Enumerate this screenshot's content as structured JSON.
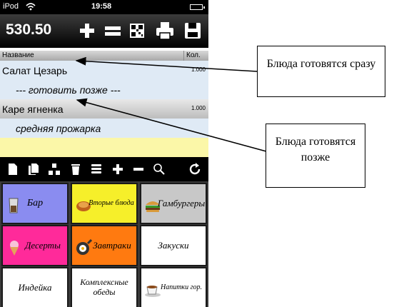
{
  "statusbar": {
    "device": "iPod",
    "time": "19:58"
  },
  "toolbar": {
    "total": "530.50",
    "icons": [
      "plus-icon",
      "equals-icon",
      "qr-code-icon",
      "printer-icon",
      "save-icon"
    ]
  },
  "table": {
    "col_name": "Название",
    "col_qty": "Кол.",
    "rows": [
      {
        "name": "Салат Цезарь",
        "qty": "1.000"
      },
      {
        "name": "--- готовить позже ---"
      },
      {
        "name": "Каре ягненка",
        "qty": "1.000"
      },
      {
        "name": "средняя прожарка"
      }
    ]
  },
  "actionbar": {
    "icons": [
      "new-document-icon",
      "copy-document-icon",
      "split-icon",
      "trash-icon",
      "stack-icon",
      "plus-icon",
      "minus-icon",
      "search-icon",
      "refresh-icon"
    ]
  },
  "categories": [
    {
      "label": "Бар",
      "color": "#8a8cf0",
      "icon": "glass-icon"
    },
    {
      "label": "Вторые блюда",
      "color": "#f6ef2a",
      "icon": "chicken-icon"
    },
    {
      "label": "Гамбургеры",
      "color": "#c8c8c8",
      "icon": "burger-icon"
    },
    {
      "label": "Десерты",
      "color": "#ff2a9a",
      "icon": "ice-cream-icon"
    },
    {
      "label": "Завтраки",
      "color": "#ff7a10",
      "icon": "pan-icon"
    },
    {
      "label": "Закуски",
      "color": "#ffffff"
    },
    {
      "label": "Индейка",
      "color": "#ffffff"
    },
    {
      "label": "Комплексные обеды",
      "color": "#ffffff"
    },
    {
      "label": "Напитки гор.",
      "color": "#ffffff",
      "icon": "cup-icon"
    }
  ],
  "annotations": {
    "now": "Блюда готовятся сразу",
    "later": "Блюда готовятся позже"
  }
}
